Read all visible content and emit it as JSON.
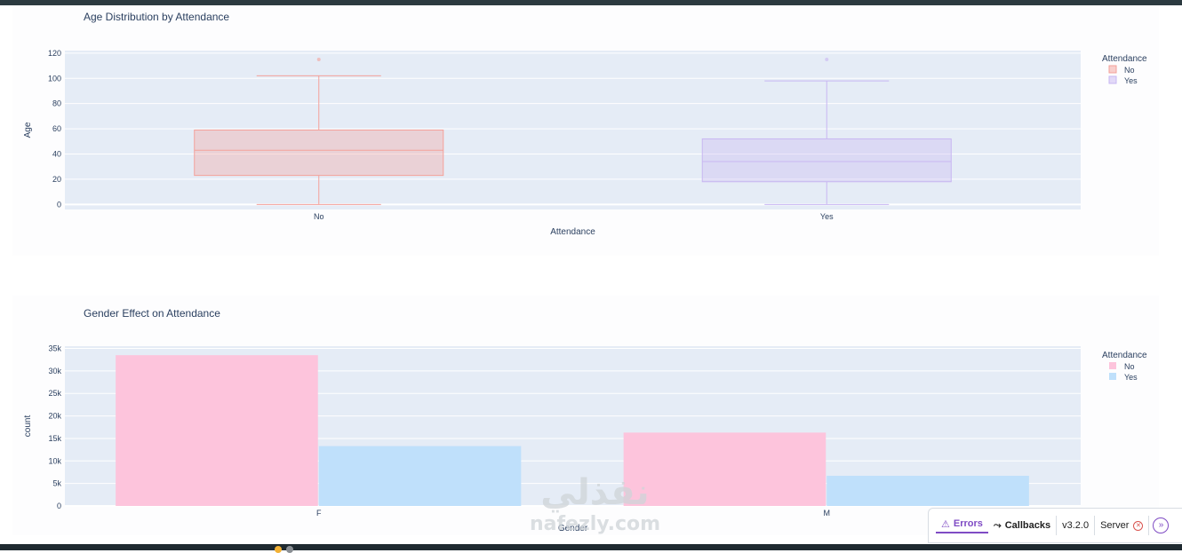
{
  "charts": [
    {
      "chart_data": {
        "type": "box",
        "title": "Age Distribution by Attendance",
        "xlabel": "Attendance",
        "ylabel": "Age",
        "categories": [
          "No",
          "Yes"
        ],
        "ylim": [
          -4,
          122
        ],
        "yticks": [
          0,
          20,
          40,
          60,
          80,
          100,
          120
        ],
        "ytick_labels": [
          "0",
          "20",
          "40",
          "60",
          "80",
          "100",
          "120"
        ],
        "legend_title": "Attendance",
        "legend_position": "top-right",
        "series": [
          {
            "name": "No",
            "color": "#f4a19a",
            "min": 0,
            "q1": 23,
            "median": 43,
            "q3": 59,
            "max": 102,
            "outliers": [
              115
            ]
          },
          {
            "name": "Yes",
            "color": "#c8b6f2",
            "min": 0,
            "q1": 18,
            "median": 34,
            "q3": 52,
            "max": 98,
            "outliers": [
              115
            ]
          }
        ]
      }
    },
    {
      "chart_data": {
        "type": "bar",
        "title": "Gender Effect on Attendance",
        "xlabel": "Gender",
        "ylabel": "count",
        "categories": [
          "F",
          "M"
        ],
        "ylim": [
          0,
          35500
        ],
        "yticks": [
          0,
          5000,
          10000,
          15000,
          20000,
          25000,
          30000,
          35000
        ],
        "ytick_labels": [
          "0",
          "5k",
          "10k",
          "15k",
          "20k",
          "25k",
          "30k",
          "35k"
        ],
        "legend_title": "Attendance",
        "legend_position": "top-right",
        "series": [
          {
            "name": "No",
            "color": "#fdc4dc",
            "values": [
              33500,
              16300
            ]
          },
          {
            "name": "Yes",
            "color": "#bfe0fb",
            "values": [
              13300,
              6700
            ]
          }
        ]
      }
    }
  ],
  "watermark": {
    "arabic": "نفذلي",
    "latin": "nafezly.com"
  },
  "devtools": {
    "errors_label": "Errors",
    "callbacks_label": "Callbacks",
    "version": "v3.2.0",
    "server_label": "Server",
    "accent": "#7f4bc4"
  }
}
